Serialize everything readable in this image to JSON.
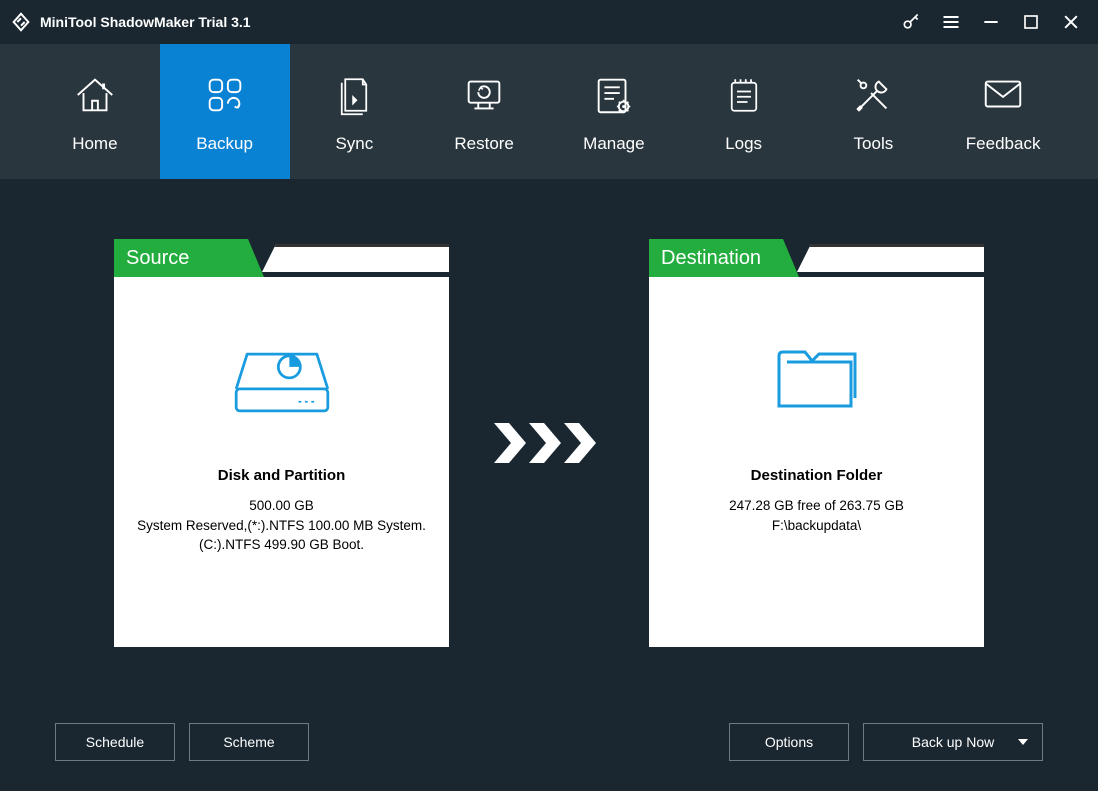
{
  "app": {
    "title": "MiniTool ShadowMaker Trial 3.1"
  },
  "nav": {
    "home": "Home",
    "backup": "Backup",
    "sync": "Sync",
    "restore": "Restore",
    "manage": "Manage",
    "logs": "Logs",
    "tools": "Tools",
    "feedback": "Feedback"
  },
  "source": {
    "header": "Source",
    "title": "Disk and Partition",
    "size": "500.00 GB",
    "detail1": "System Reserved,(*:).NTFS 100.00 MB System.",
    "detail2": "(C:).NTFS 499.90 GB Boot."
  },
  "destination": {
    "header": "Destination",
    "title": "Destination Folder",
    "free": "247.28 GB free of 263.75 GB",
    "path": "F:\\backupdata\\"
  },
  "buttons": {
    "schedule": "Schedule",
    "scheme": "Scheme",
    "options": "Options",
    "backup_now": "Back up Now"
  }
}
